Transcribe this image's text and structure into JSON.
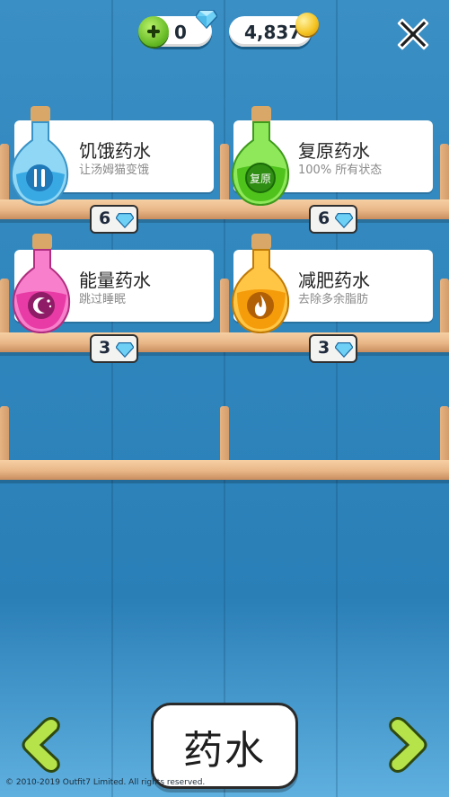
{
  "header": {
    "gems": "0",
    "coins": "4,837"
  },
  "potions": [
    {
      "name": "饥饿药水",
      "desc": "让汤姆猫变饿",
      "price": "6",
      "color": "#7fd3f7",
      "emblem": "fork-knife-icon"
    },
    {
      "name": "复原药水",
      "desc": "100% 所有状态",
      "price": "6",
      "color": "#6fdc3a",
      "emblem_text": "复原"
    },
    {
      "name": "能量药水",
      "desc": "跳过睡眠",
      "price": "3",
      "color": "#f24fb3",
      "emblem": "moon-stars-icon"
    },
    {
      "name": "减肥药水",
      "desc": "去除多余脂肪",
      "price": "3",
      "color": "#f7a20f",
      "emblem": "flame-icon"
    }
  ],
  "footer": {
    "category_label": "药水",
    "copyright": "© 2010-2019 Outfit7 Limited. All rights reserved."
  }
}
